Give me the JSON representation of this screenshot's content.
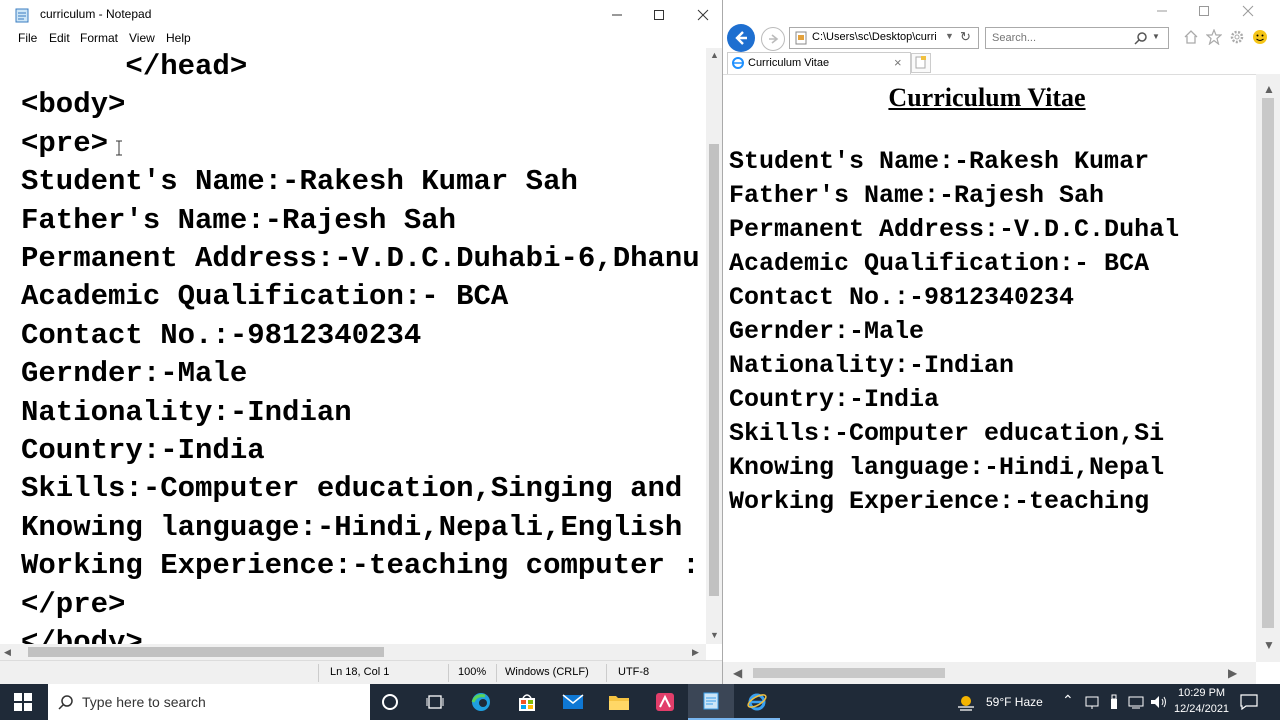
{
  "notepad": {
    "title": "curriculum - Notepad",
    "menu": [
      "File",
      "Edit",
      "Format",
      "View",
      "Help"
    ],
    "lines": [
      "      </head>",
      "<body>",
      "<pre>",
      "Student's Name:-Rakesh Kumar Sah",
      "Father's Name:-Rajesh Sah",
      "Permanent Address:-V.D.C.Duhabi-6,Dhanu",
      "Academic Qualification:- BCA",
      "Contact No.:-9812340234",
      "Gernder:-Male",
      "Nationality:-Indian",
      "Country:-India",
      "Skills:-Computer education,Singing and",
      "Knowing language:-Hindi,Nepali,English",
      "Working Experience:-teaching computer :",
      "</pre>",
      "</body>"
    ],
    "status": {
      "position": "Ln 18, Col 1",
      "zoom": "100%",
      "line_ending": "Windows (CRLF)",
      "encoding": "UTF-8"
    }
  },
  "browser": {
    "address": "C:\\Users\\sc\\Desktop\\curri",
    "search_placeholder": "Search...",
    "tab_title": "Curriculum Vitae",
    "page_heading": "Curriculum Vitae",
    "lines": [
      "Student's Name:-Rakesh Kumar",
      "Father's Name:-Rajesh Sah",
      "Permanent Address:-V.D.C.Duhal",
      "Academic Qualification:- BCA",
      "Contact No.:-9812340234",
      "Gernder:-Male",
      "Nationality:-Indian",
      "Country:-India",
      "Skills:-Computer education,Si",
      "Knowing language:-Hindi,Nepal",
      "Working Experience:-teaching"
    ]
  },
  "taskbar": {
    "search_placeholder": "Type here to search",
    "weather": "59°F  Haze",
    "time": "10:29 PM",
    "date": "12/24/2021"
  }
}
